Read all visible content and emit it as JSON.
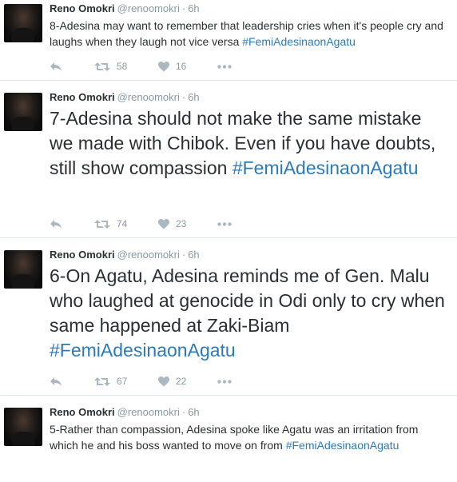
{
  "tweets": [
    {
      "name": "Reno Omokri",
      "handle": "@renoomokri",
      "time": "6h",
      "text": "8-Adesina may want to remember that leadership cries when it's people cry and laughs when they laugh not vice versa ",
      "hashtag": "#FemiAdesinaonAgatu",
      "retweets": "58",
      "likes": "16"
    },
    {
      "name": "Reno Omokri",
      "handle": "@renoomokri",
      "time": "6h",
      "text": "7-Adesina should not make the same mistake we made with Chibok. Even if you have doubts, still show compassion ",
      "hashtag": "#FemiAdesinaonAgatu",
      "retweets": "74",
      "likes": "23"
    },
    {
      "name": "Reno Omokri",
      "handle": "@renoomokri",
      "time": "6h",
      "text": "6-On Agatu, Adesina reminds me of Gen. Malu who laughed at genocide in Odi only to cry when same happened at Zaki-Biam ",
      "hashtag": "#FemiAdesinaonAgatu",
      "retweets": "67",
      "likes": "22"
    },
    {
      "name": "Reno Omokri",
      "handle": "@renoomokri",
      "time": "6h",
      "text": "5-Rather than compassion, Adesina spoke like Agatu was an irritation from which he and his boss wanted to move on from ",
      "hashtag": "#FemiAdesinaonAgatu"
    }
  ],
  "separator": "·",
  "icons": {
    "reply": "reply-icon",
    "retweet": "retweet-icon",
    "like": "heart-icon",
    "more": "more-icon"
  },
  "colors": {
    "hashtag": "#2b7bb9",
    "meta": "#8899a6",
    "text": "#292f33",
    "border": "#e1e8ed"
  }
}
